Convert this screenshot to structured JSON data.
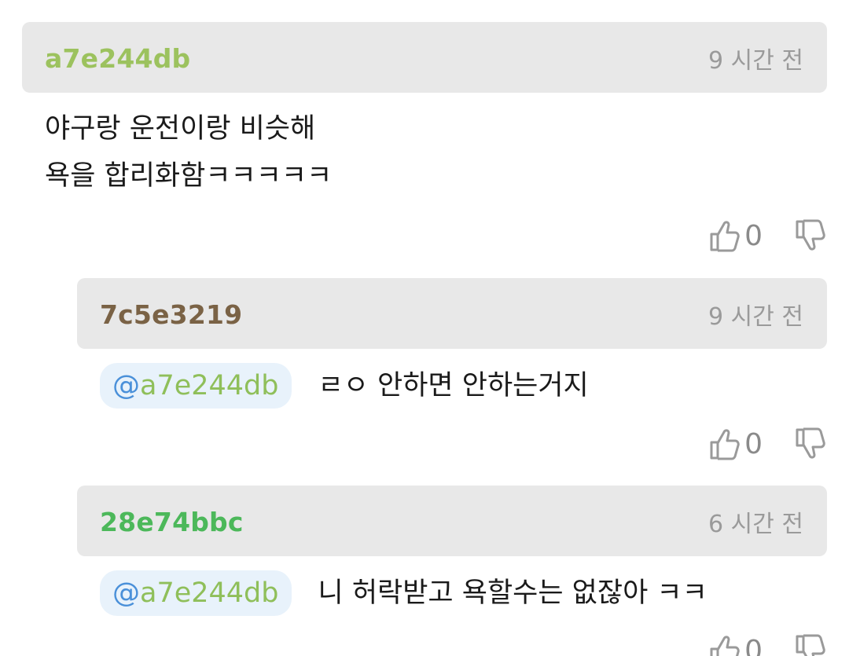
{
  "comments": [
    {
      "author": "a7e244db",
      "author_color": "#9cc25e",
      "time": "9 시간 전",
      "lines": [
        "야구랑 운전이랑 비슷해",
        "욕을 합리화함ㅋㅋㅋㅋㅋ"
      ],
      "likes": "0",
      "like_icon": "thumbs-up-icon",
      "dislike_icon": "thumbs-down-icon"
    },
    {
      "author": "7c5e3219",
      "author_color": "#7a6245",
      "time": "9 시간 전",
      "mention_at": "@",
      "mention_name": "a7e244db",
      "text": "ㄹㅇ 안하면 안하는거지",
      "likes": "0"
    },
    {
      "author": "28e74bbc",
      "author_color": "#4cb85a",
      "time": "6 시간 전",
      "mention_at": "@",
      "mention_name": "a7e244db",
      "text": "니 허락받고 욕할수는 없잖아 ㅋㅋ",
      "likes": "0"
    }
  ],
  "colors": {
    "mention_bg": "#e8f2fb",
    "mention_at": "#4a90d9",
    "mention_name": "#8fbf5a",
    "header_bg": "#e8e8e8"
  }
}
